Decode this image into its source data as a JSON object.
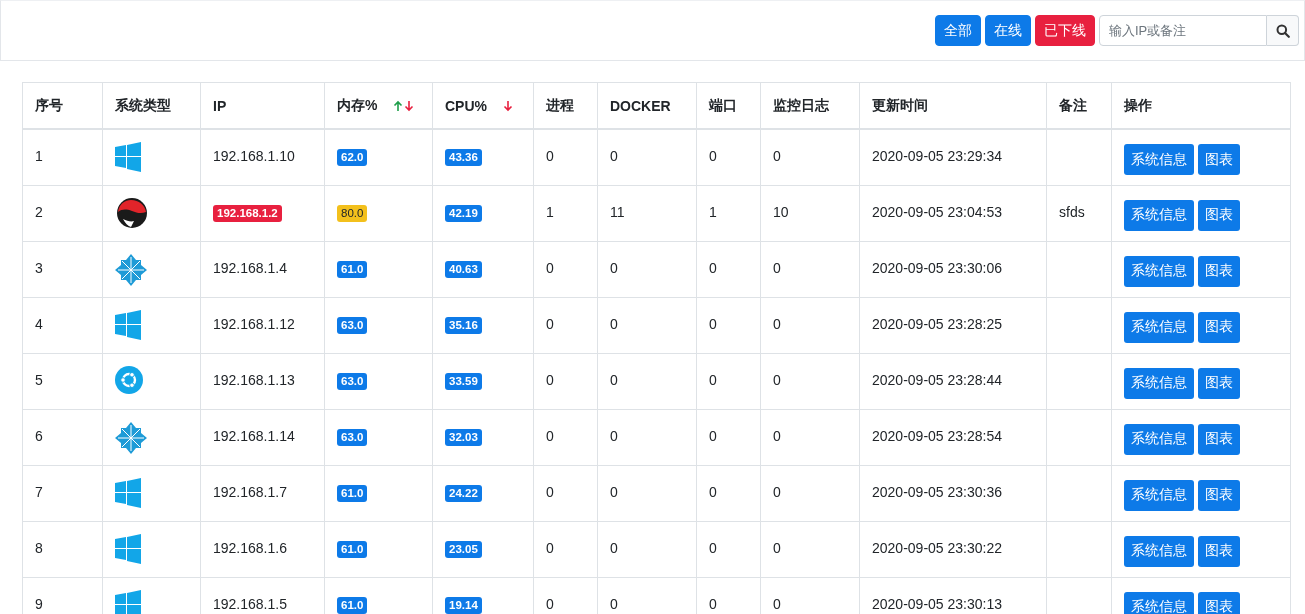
{
  "filters": [
    {
      "label": "全部",
      "color": "#0d7ae8"
    },
    {
      "label": "在线",
      "color": "#0d7ae8"
    },
    {
      "label": "已下线",
      "color": "#e8203f"
    }
  ],
  "search": {
    "placeholder": "输入IP或备注"
  },
  "table": {
    "columns": [
      {
        "label": "序号"
      },
      {
        "label": "系统类型"
      },
      {
        "label": "IP"
      },
      {
        "label": "内存%",
        "sort_up": true,
        "sort_down": true
      },
      {
        "label": "CPU%",
        "sort_down": true
      },
      {
        "label": "进程"
      },
      {
        "label": "DOCKER"
      },
      {
        "label": "端口"
      },
      {
        "label": "监控日志"
      },
      {
        "label": "更新时间"
      },
      {
        "label": "备注"
      },
      {
        "label": "操作"
      }
    ],
    "rows": [
      {
        "no": "1",
        "kind": "windows",
        "ip": "192.168.1.10",
        "offline": false,
        "mem": "62.0",
        "mem_high": false,
        "cpu": "43.36",
        "proc": "0",
        "docker": "0",
        "port": "0",
        "log": "0",
        "time": "2020-09-05 23:29:34",
        "actions": [
          "系统信息",
          "图表"
        ]
      },
      {
        "no": "2",
        "kind": "redhat",
        "ip": "192.168.1.2",
        "offline": true,
        "mem": "80.0",
        "mem_high": true,
        "cpu": "42.19",
        "proc": "1",
        "docker": "11",
        "port": "1",
        "log": "10",
        "time": "2020-09-05 23:04:53",
        "note": "sfds",
        "actions": [
          "系统信息",
          "图表"
        ]
      },
      {
        "no": "3",
        "kind": "centos",
        "ip": "192.168.1.4",
        "offline": false,
        "mem": "61.0",
        "mem_high": false,
        "cpu": "40.63",
        "proc": "0",
        "docker": "0",
        "port": "0",
        "log": "0",
        "time": "2020-09-05 23:30:06",
        "actions": [
          "系统信息",
          "图表"
        ]
      },
      {
        "no": "4",
        "kind": "windows",
        "ip": "192.168.1.12",
        "offline": false,
        "mem": "63.0",
        "mem_high": false,
        "cpu": "35.16",
        "proc": "0",
        "docker": "0",
        "port": "0",
        "log": "0",
        "time": "2020-09-05 23:28:25",
        "actions": [
          "系统信息",
          "图表"
        ]
      },
      {
        "no": "5",
        "kind": "ubuntu",
        "ip": "192.168.1.13",
        "offline": false,
        "mem": "63.0",
        "mem_high": false,
        "cpu": "33.59",
        "proc": "0",
        "docker": "0",
        "port": "0",
        "log": "0",
        "time": "2020-09-05 23:28:44",
        "actions": [
          "系统信息",
          "图表"
        ]
      },
      {
        "no": "6",
        "kind": "centos",
        "ip": "192.168.1.14",
        "offline": false,
        "mem": "63.0",
        "mem_high": false,
        "cpu": "32.03",
        "proc": "0",
        "docker": "0",
        "port": "0",
        "log": "0",
        "time": "2020-09-05 23:28:54",
        "actions": [
          "系统信息",
          "图表"
        ]
      },
      {
        "no": "7",
        "kind": "windows",
        "ip": "192.168.1.7",
        "offline": false,
        "mem": "61.0",
        "mem_high": false,
        "cpu": "24.22",
        "proc": "0",
        "docker": "0",
        "port": "0",
        "log": "0",
        "time": "2020-09-05 23:30:36",
        "actions": [
          "系统信息",
          "图表"
        ]
      },
      {
        "no": "8",
        "kind": "windows",
        "ip": "192.168.1.6",
        "offline": false,
        "mem": "61.0",
        "mem_high": false,
        "cpu": "23.05",
        "proc": "0",
        "docker": "0",
        "port": "0",
        "log": "0",
        "time": "2020-09-05 23:30:22",
        "actions": [
          "系统信息",
          "图表"
        ]
      },
      {
        "no": "9",
        "kind": "windows",
        "ip": "192.168.1.5",
        "offline": false,
        "mem": "61.0",
        "mem_high": false,
        "cpu": "19.14",
        "proc": "0",
        "docker": "0",
        "port": "0",
        "log": "0",
        "time": "2020-09-05 23:30:13",
        "actions": [
          "系统信息",
          "图表"
        ]
      }
    ]
  }
}
